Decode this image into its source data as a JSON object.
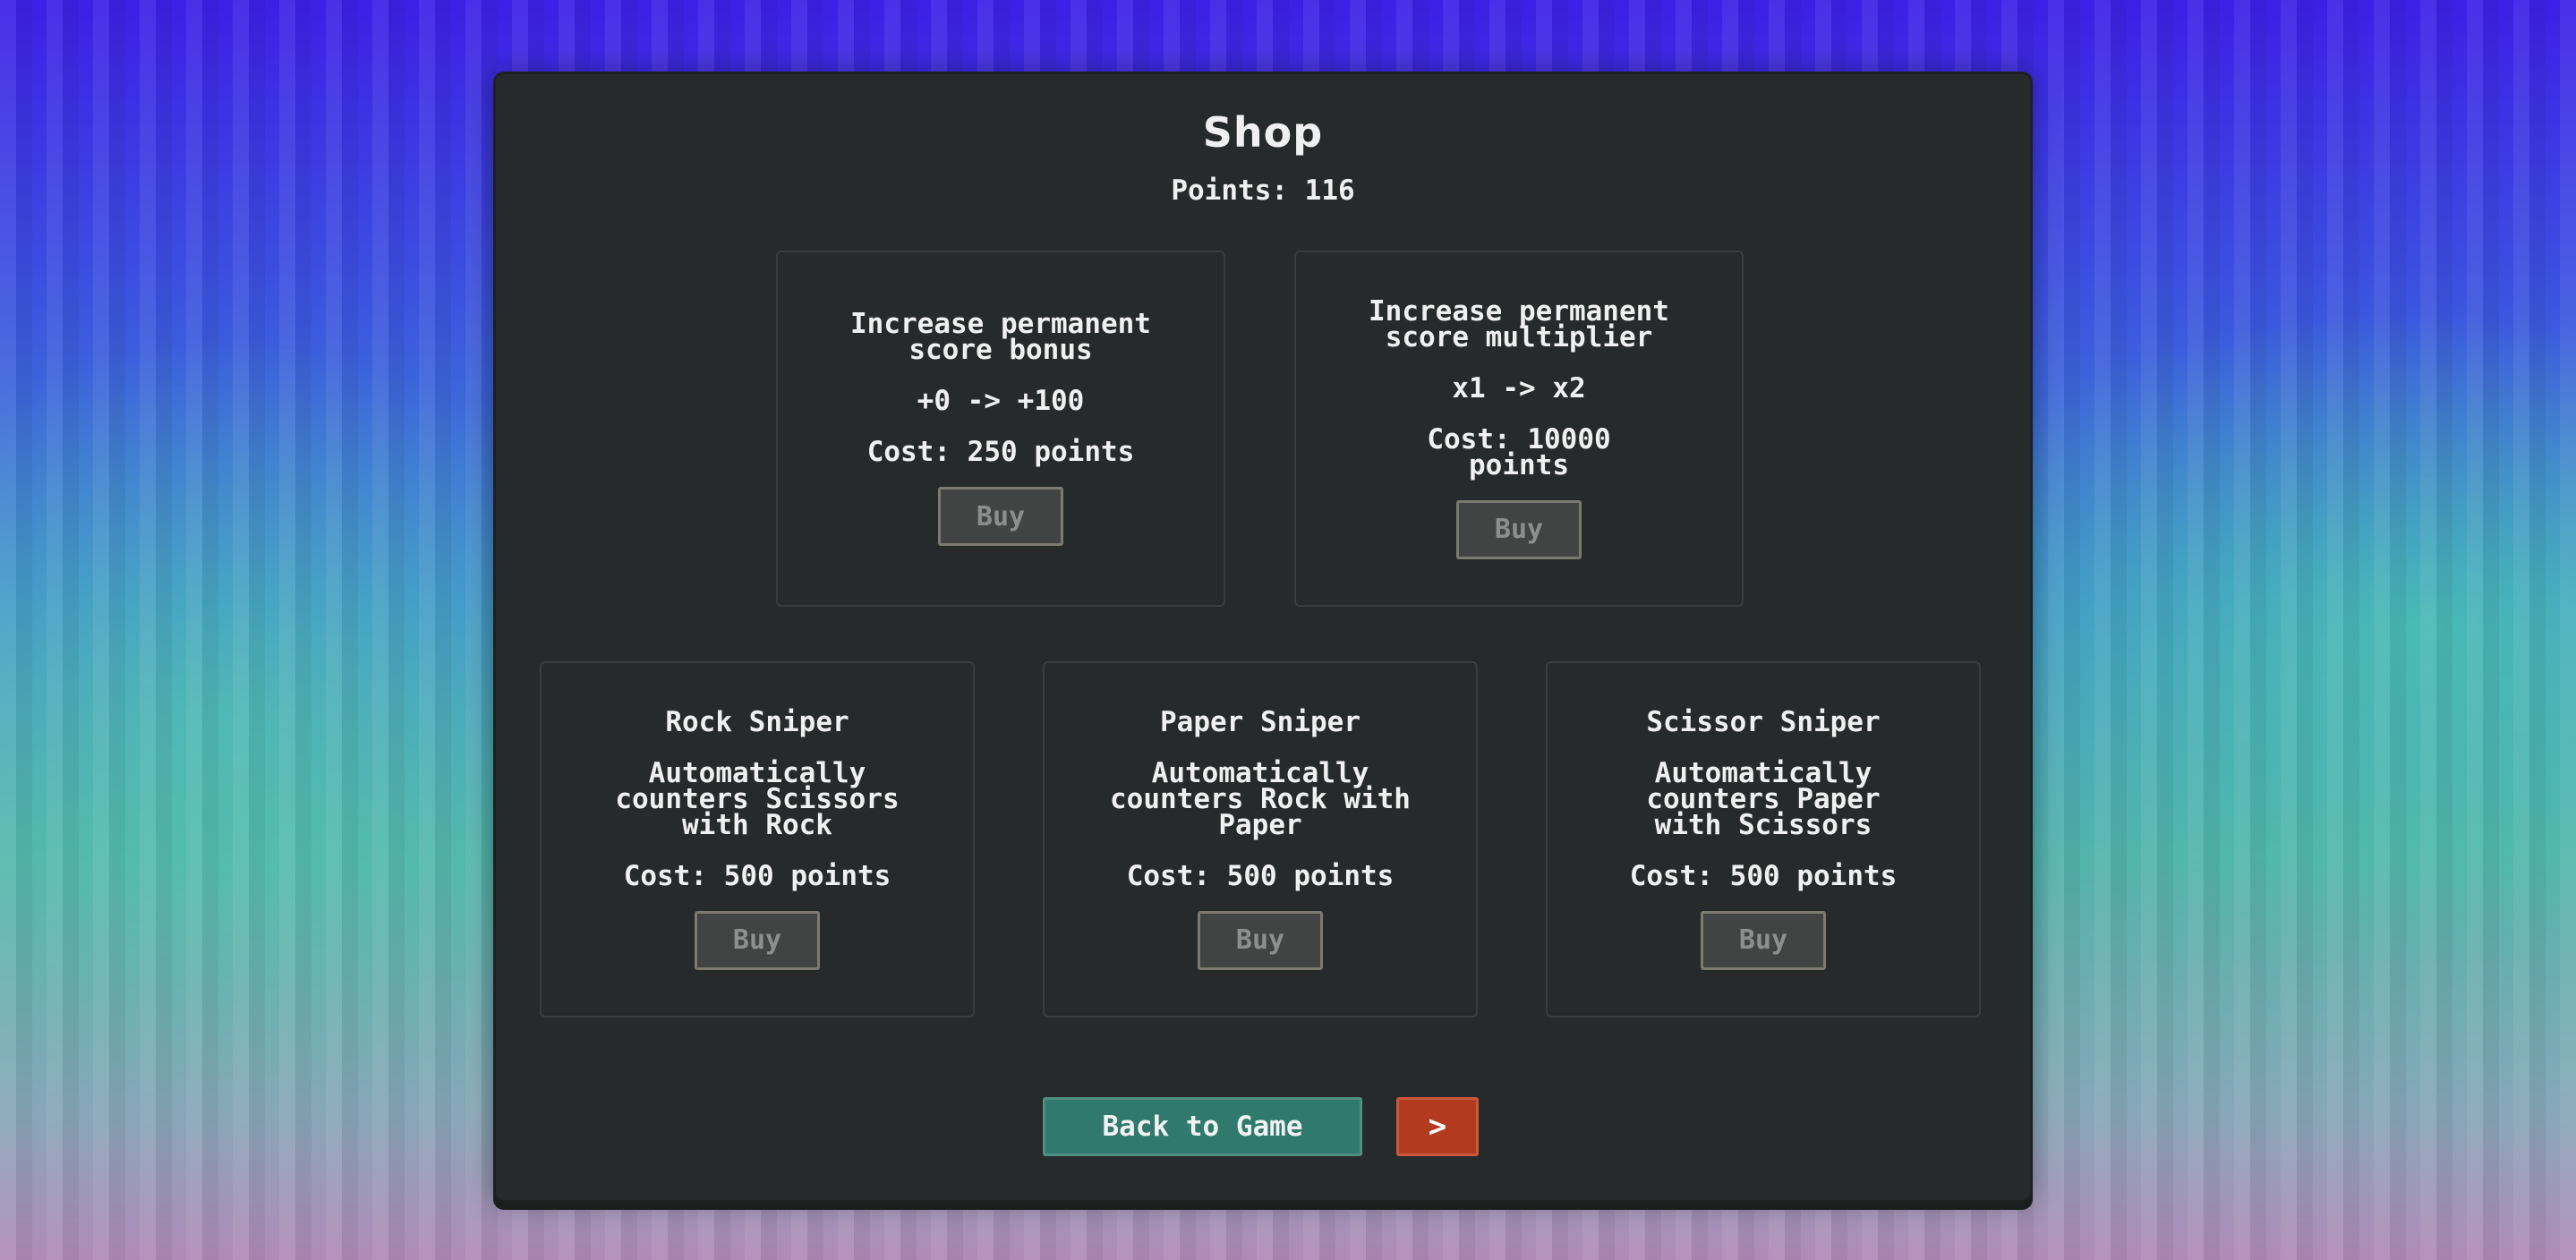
{
  "shop": {
    "title": "Shop",
    "points_label": "Points: 116"
  },
  "upgrades": [
    {
      "title": "Increase permanent score bonus",
      "change": "+0 -> +100",
      "cost": "Cost: 250 points",
      "buy_label": "Buy"
    },
    {
      "title": "Increase permanent score multiplier",
      "change": "x1 -> x2",
      "cost": "Cost: 10000 points",
      "buy_label": "Buy"
    }
  ],
  "snipers": [
    {
      "title": "Rock Sniper",
      "desc": "Automatically counters Scissors with Rock",
      "cost": "Cost: 500 points",
      "buy_label": "Buy"
    },
    {
      "title": "Paper Sniper",
      "desc": "Automatically counters Rock with Paper",
      "cost": "Cost: 500 points",
      "buy_label": "Buy"
    },
    {
      "title": "Scissor Sniper",
      "desc": "Automatically counters Paper with Scissors",
      "cost": "Cost: 500 points",
      "buy_label": "Buy"
    }
  ],
  "footer": {
    "back_label": "Back to Game",
    "next_label": ">"
  },
  "colors": {
    "panel": "#272a2a",
    "back_button": "#2f7a6c",
    "next_button": "#b23a1e",
    "buy_button_disabled": "#424444"
  }
}
